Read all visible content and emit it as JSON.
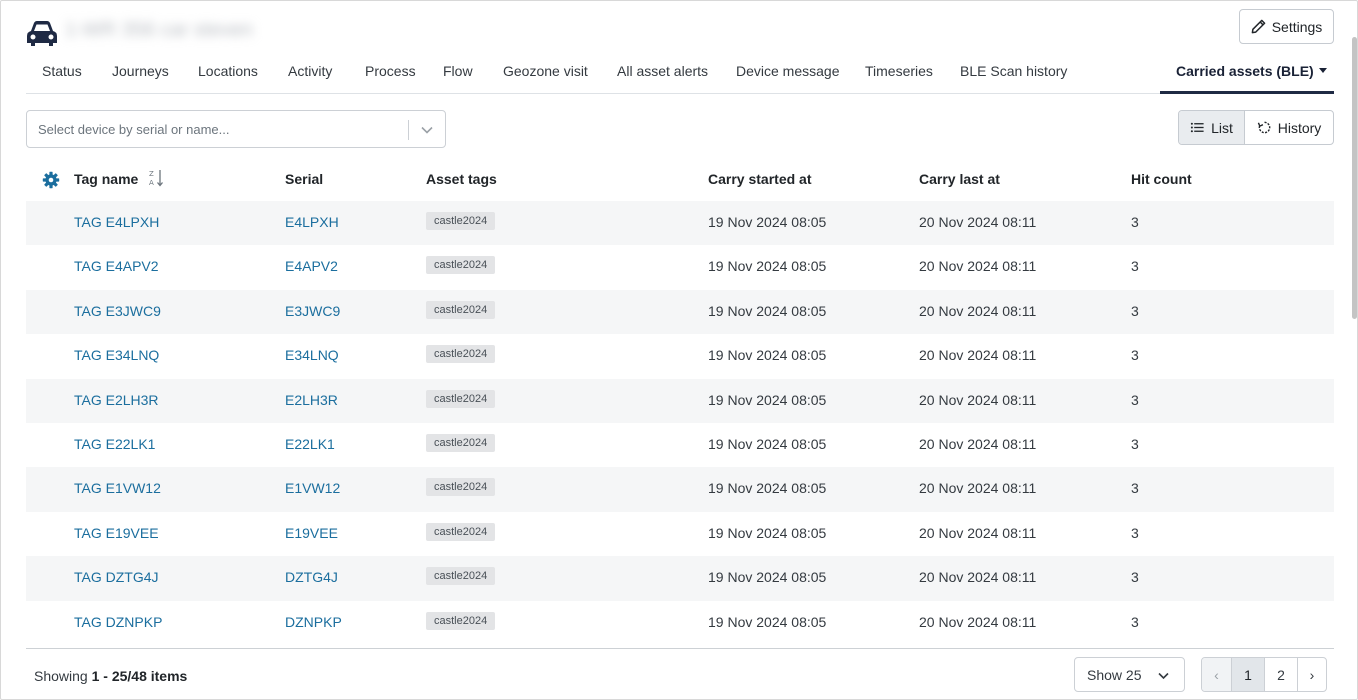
{
  "header": {
    "asset_title": "1-WR 356 car steven",
    "settings_label": "Settings"
  },
  "tabs": [
    {
      "label": "Status"
    },
    {
      "label": "Journeys"
    },
    {
      "label": "Locations"
    },
    {
      "label": "Activity"
    },
    {
      "label": "Process"
    },
    {
      "label": "Flow"
    },
    {
      "label": "Geozone visit"
    },
    {
      "label": "All asset alerts"
    },
    {
      "label": "Device message"
    },
    {
      "label": "Timeseries"
    },
    {
      "label": "BLE Scan history"
    },
    {
      "label": "Carried assets (BLE)",
      "active": true
    }
  ],
  "device_select": {
    "placeholder": "Select device by serial or name..."
  },
  "view_toggle": {
    "list_label": "List",
    "history_label": "History",
    "selected": "List"
  },
  "table": {
    "columns": [
      "Tag name",
      "Serial",
      "Asset tags",
      "Carry started at",
      "Carry last at",
      "Hit count"
    ],
    "rows": [
      {
        "tag_name": "TAG E4LPXH",
        "serial": "E4LPXH",
        "asset_tag": "castle2024",
        "started": "19 Nov 2024 08:05",
        "last": "20 Nov 2024 08:11",
        "hits": "3"
      },
      {
        "tag_name": "TAG E4APV2",
        "serial": "E4APV2",
        "asset_tag": "castle2024",
        "started": "19 Nov 2024 08:05",
        "last": "20 Nov 2024 08:11",
        "hits": "3"
      },
      {
        "tag_name": "TAG E3JWC9",
        "serial": "E3JWC9",
        "asset_tag": "castle2024",
        "started": "19 Nov 2024 08:05",
        "last": "20 Nov 2024 08:11",
        "hits": "3"
      },
      {
        "tag_name": "TAG E34LNQ",
        "serial": "E34LNQ",
        "asset_tag": "castle2024",
        "started": "19 Nov 2024 08:05",
        "last": "20 Nov 2024 08:11",
        "hits": "3"
      },
      {
        "tag_name": "TAG E2LH3R",
        "serial": "E2LH3R",
        "asset_tag": "castle2024",
        "started": "19 Nov 2024 08:05",
        "last": "20 Nov 2024 08:11",
        "hits": "3"
      },
      {
        "tag_name": "TAG E22LK1",
        "serial": "E22LK1",
        "asset_tag": "castle2024",
        "started": "19 Nov 2024 08:05",
        "last": "20 Nov 2024 08:11",
        "hits": "3"
      },
      {
        "tag_name": "TAG E1VW12",
        "serial": "E1VW12",
        "asset_tag": "castle2024",
        "started": "19 Nov 2024 08:05",
        "last": "20 Nov 2024 08:11",
        "hits": "3"
      },
      {
        "tag_name": "TAG E19VEE",
        "serial": "E19VEE",
        "asset_tag": "castle2024",
        "started": "19 Nov 2024 08:05",
        "last": "20 Nov 2024 08:11",
        "hits": "3"
      },
      {
        "tag_name": "TAG DZTG4J",
        "serial": "DZTG4J",
        "asset_tag": "castle2024",
        "started": "19 Nov 2024 08:05",
        "last": "20 Nov 2024 08:11",
        "hits": "3"
      },
      {
        "tag_name": "TAG DZNPKP",
        "serial": "DZNPKP",
        "asset_tag": "castle2024",
        "started": "19 Nov 2024 08:05",
        "last": "20 Nov 2024 08:11",
        "hits": "3"
      }
    ]
  },
  "footer": {
    "showing_prefix": "Showing",
    "showing_range": "1 - 25/48 items",
    "page_size_label": "Show 25",
    "pagination": {
      "prev": "‹",
      "pages": [
        "1",
        "2"
      ],
      "current": "1",
      "next": "›"
    }
  },
  "colors": {
    "link": "#1b6e9e",
    "active_tab_underline": "#1f2a44",
    "gear_icon": "#1b6e9e",
    "stripe": "#f5f6f7"
  }
}
